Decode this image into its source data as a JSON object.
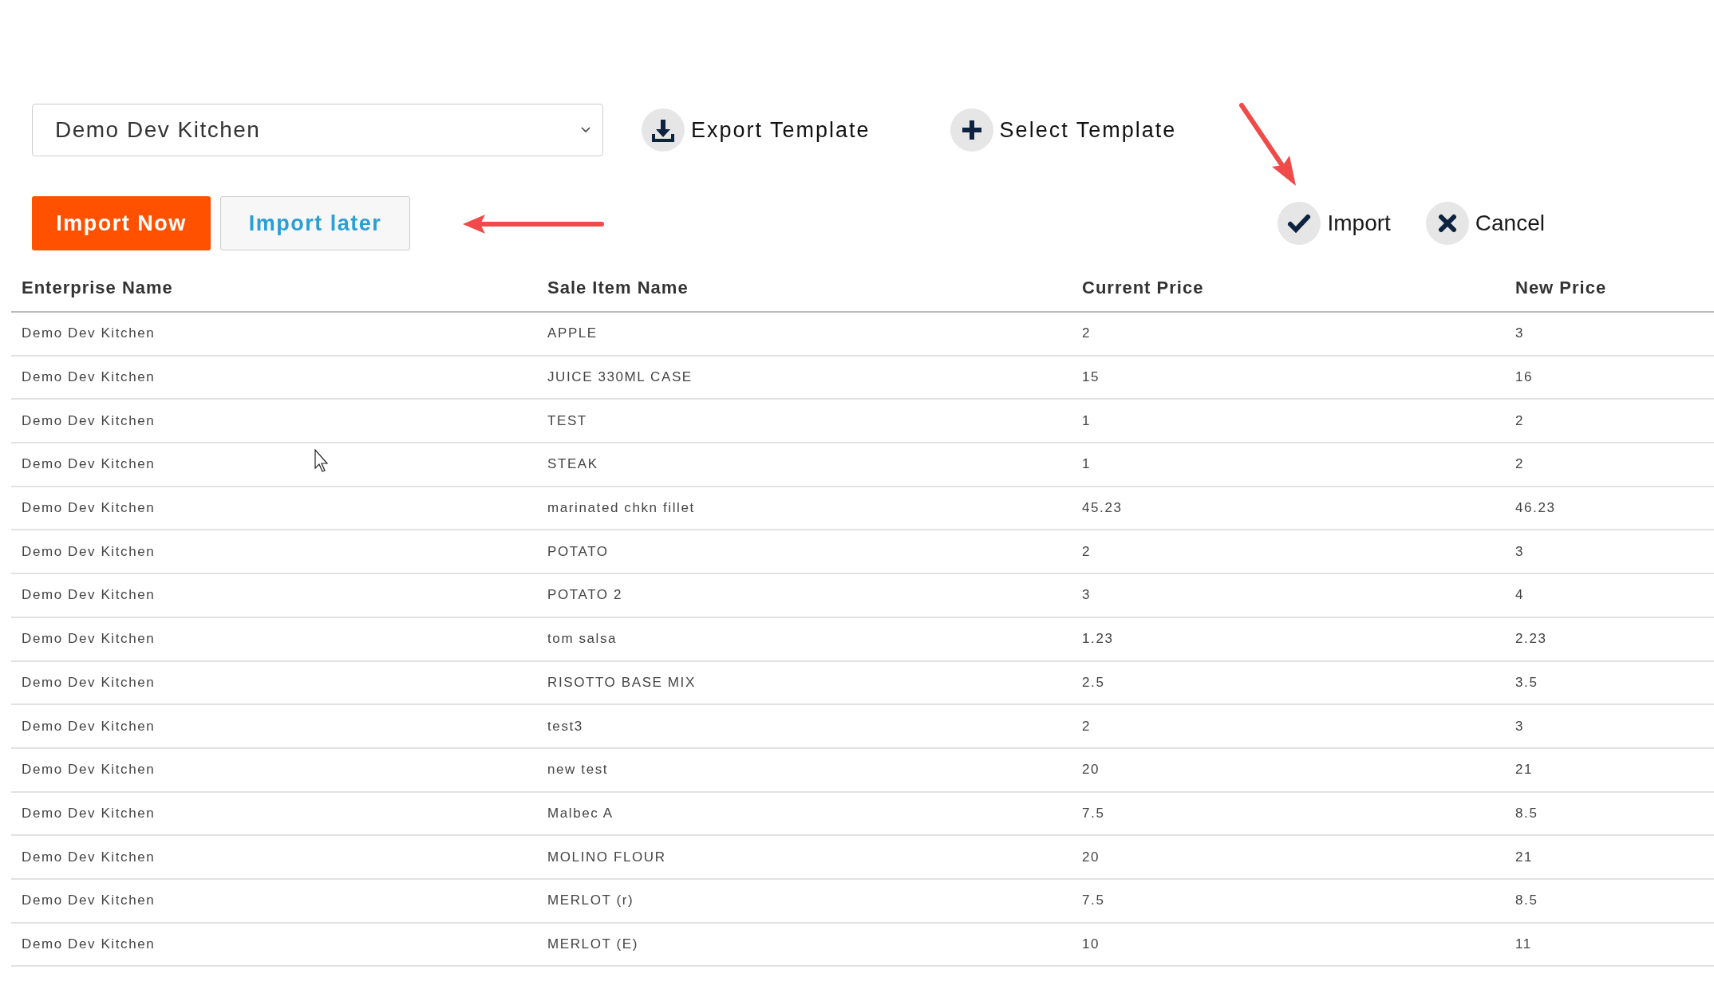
{
  "selector": {
    "value": "Demo Dev Kitchen"
  },
  "template_actions": [
    {
      "kind": "export",
      "label": "Export Template"
    },
    {
      "kind": "select",
      "label": "Select Template"
    }
  ],
  "import_buttons": [
    {
      "kind": "primary",
      "label": "Import Now"
    },
    {
      "kind": "secondary",
      "label": "Import later"
    }
  ],
  "actions": [
    {
      "kind": "confirm",
      "label": "Import"
    },
    {
      "kind": "cancel",
      "label": "Cancel"
    }
  ],
  "table": {
    "columns": [
      "Enterprise Name",
      "Sale Item Name",
      "Current Price",
      "New Price"
    ],
    "rows": [
      [
        "Demo Dev Kitchen",
        "APPLE",
        "2",
        "3"
      ],
      [
        "Demo Dev Kitchen",
        "JUICE 330ML CASE",
        "15",
        "16"
      ],
      [
        "Demo Dev Kitchen",
        "TEST",
        "1",
        "2"
      ],
      [
        "Demo Dev Kitchen",
        "STEAK",
        "1",
        "2"
      ],
      [
        "Demo Dev Kitchen",
        "marinated chkn fillet",
        "45.23",
        "46.23"
      ],
      [
        "Demo Dev Kitchen",
        "POTATO",
        "2",
        "3"
      ],
      [
        "Demo Dev Kitchen",
        "POTATO 2",
        "3",
        "4"
      ],
      [
        "Demo Dev Kitchen",
        "tom salsa",
        "1.23",
        "2.23"
      ],
      [
        "Demo Dev Kitchen",
        "RISOTTO BASE MIX",
        "2.5",
        "3.5"
      ],
      [
        "Demo Dev Kitchen",
        "test3",
        "2",
        "3"
      ],
      [
        "Demo Dev Kitchen",
        "new test",
        "20",
        "21"
      ],
      [
        "Demo Dev Kitchen",
        "Malbec A",
        "7.5",
        "8.5"
      ],
      [
        "Demo Dev Kitchen",
        "MOLINO FLOUR",
        "20",
        "21"
      ],
      [
        "Demo Dev Kitchen",
        "MERLOT (r)",
        "7.5",
        "8.5"
      ],
      [
        "Demo Dev Kitchen",
        "MERLOT (E)",
        "10",
        "11"
      ]
    ]
  }
}
